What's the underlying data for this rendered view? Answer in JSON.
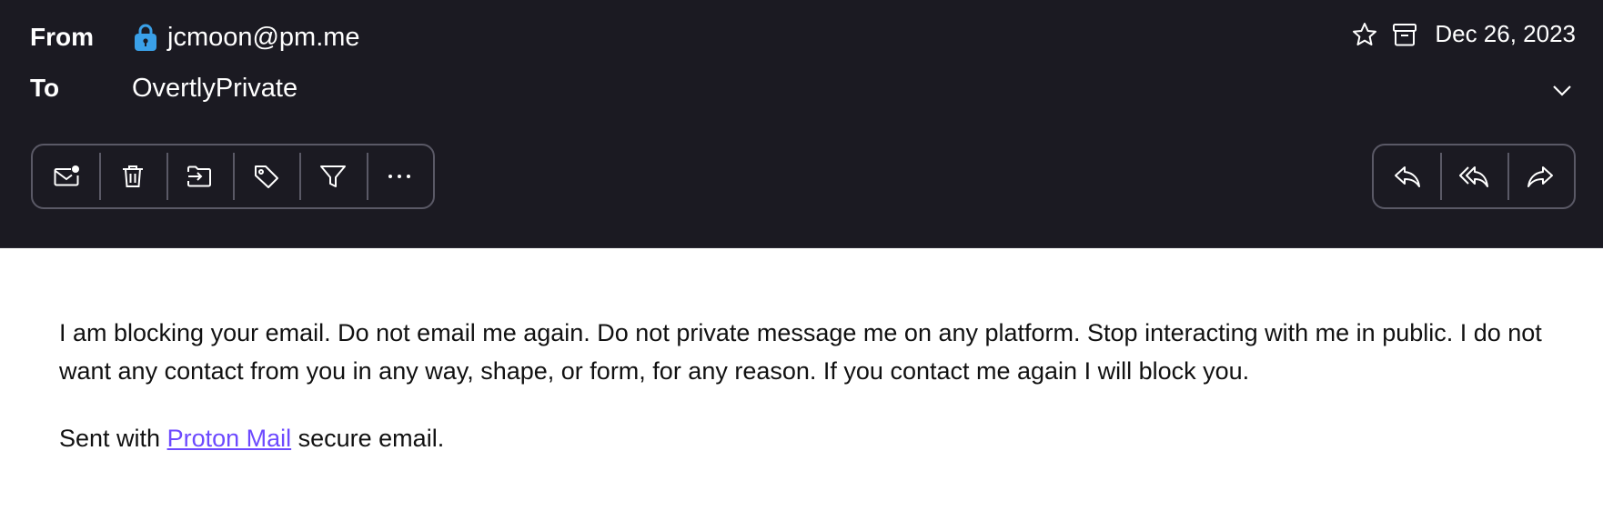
{
  "header": {
    "from_label": "From",
    "from_value": "jcmoon@pm.me",
    "to_label": "To",
    "to_value": "OvertlyPrivate",
    "date": "Dec 26, 2023",
    "icons": {
      "lock": "lock-icon",
      "star": "star-icon",
      "archive": "archive-icon",
      "expand": "chevron-down-icon"
    },
    "lock_color": "#3aa0e8"
  },
  "toolbar_left": {
    "items": [
      "mark-unread-icon",
      "trash-icon",
      "move-to-folder-icon",
      "label-icon",
      "filter-icon",
      "more-icon"
    ]
  },
  "toolbar_right": {
    "items": [
      "reply-icon",
      "reply-all-icon",
      "forward-icon"
    ]
  },
  "message": {
    "body": "I am blocking your email. Do not email me again. Do not private message me on any platform. Stop interacting with me in public. I do not want any contact from you in any way, shape, or form, for any reason. If you contact me again I will block you.",
    "signature_prefix": "Sent with ",
    "signature_link": "Proton Mail",
    "signature_suffix": " secure email.",
    "link_color": "#6d4aff"
  }
}
